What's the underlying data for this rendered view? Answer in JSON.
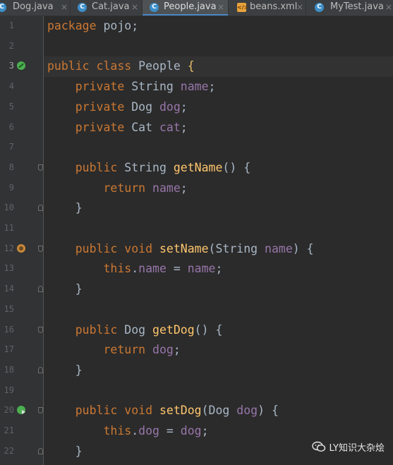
{
  "tabs": [
    {
      "label": "Dog.java",
      "icon": "java-class-icon",
      "active": false
    },
    {
      "label": "Cat.java",
      "icon": "java-class-icon",
      "active": false
    },
    {
      "label": "People.java",
      "icon": "java-class-icon",
      "active": true
    },
    {
      "label": "beans.xml",
      "icon": "xml-file-icon",
      "active": false
    },
    {
      "label": "MyTest.java",
      "icon": "java-class-icon",
      "active": false
    }
  ],
  "tab_close_glyph": "×",
  "editor": {
    "lines": [
      {
        "n": "1",
        "text": "package pojo;"
      },
      {
        "n": "2",
        "text": ""
      },
      {
        "n": "3",
        "text": "public class People {"
      },
      {
        "n": "4",
        "text": "    private String name;"
      },
      {
        "n": "5",
        "text": "    private Dog dog;"
      },
      {
        "n": "6",
        "text": "    private Cat cat;"
      },
      {
        "n": "7",
        "text": ""
      },
      {
        "n": "8",
        "text": "    public String getName() {"
      },
      {
        "n": "9",
        "text": "        return name;"
      },
      {
        "n": "10",
        "text": "    }"
      },
      {
        "n": "11",
        "text": ""
      },
      {
        "n": "12",
        "text": "    public void setName(String name) {"
      },
      {
        "n": "13",
        "text": "        this.name = name;"
      },
      {
        "n": "14",
        "text": "    }"
      },
      {
        "n": "15",
        "text": ""
      },
      {
        "n": "16",
        "text": "    public Dog getDog() {"
      },
      {
        "n": "17",
        "text": "        return dog;"
      },
      {
        "n": "18",
        "text": "    }"
      },
      {
        "n": "19",
        "text": ""
      },
      {
        "n": "20",
        "text": "    public void setDog(Dog dog) {"
      },
      {
        "n": "21",
        "text": "        this.dog = dog;"
      },
      {
        "n": "22",
        "text": "    }"
      }
    ],
    "current_line": "3",
    "gutter_marks": {
      "3": "bean-icon",
      "12": "override-icon",
      "20": "bean-navigate-icon"
    },
    "fold_markers": {
      "8": "start",
      "10": "end",
      "12": "start",
      "14": "end",
      "16": "start",
      "18": "end",
      "20": "start",
      "22": "end"
    }
  },
  "colors": {
    "background": "#2b2b2b",
    "keyword": "#cc7832",
    "field": "#9876aa",
    "method": "#ffc66d",
    "text": "#a9b7c6",
    "line_number": "#606366",
    "active_tab_underline": "#4a88c7"
  },
  "watermark": {
    "label": "LY知识大杂烩",
    "icon": "wechat-icon"
  }
}
